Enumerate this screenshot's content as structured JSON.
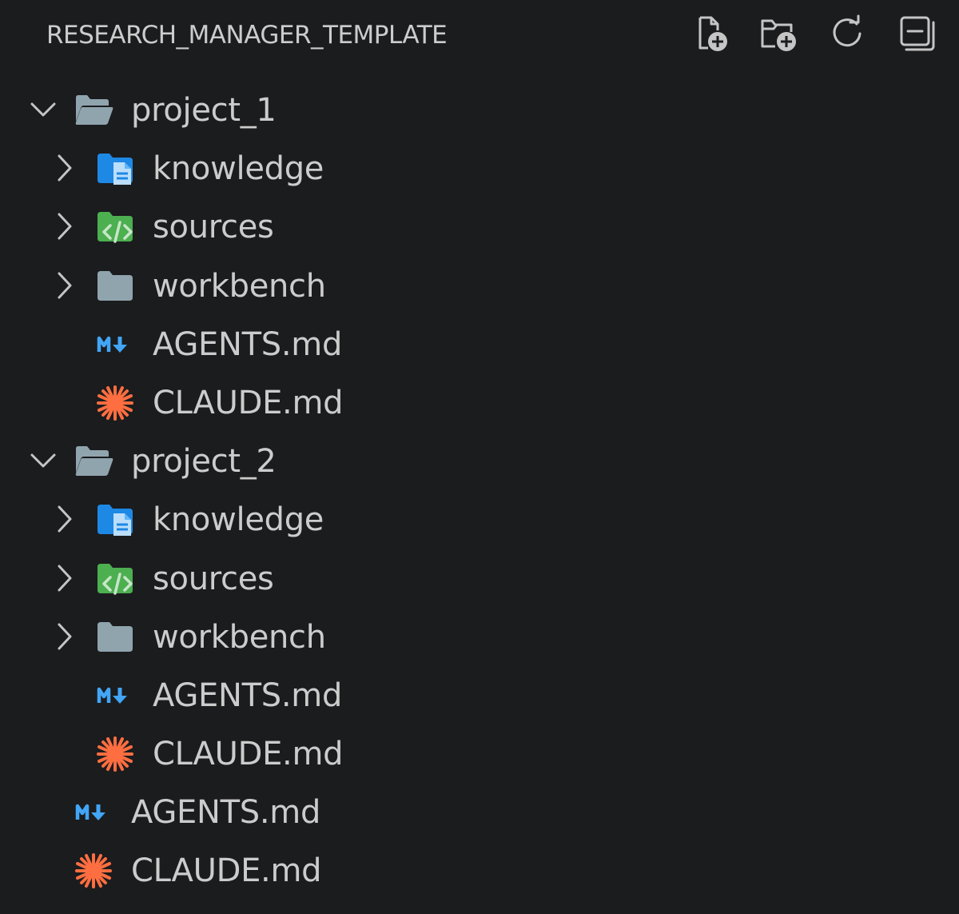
{
  "explorer": {
    "title": "RESEARCH_MANAGER_TEMPLATE"
  },
  "actions": [
    {
      "name": "new-file-button",
      "icon": "new-file-icon"
    },
    {
      "name": "new-folder-button",
      "icon": "new-folder-icon"
    },
    {
      "name": "refresh-explorer-button",
      "icon": "refresh-icon"
    },
    {
      "name": "collapse-folders-button",
      "icon": "collapse-all-icon"
    }
  ],
  "colors": {
    "background": "#1b1c1e",
    "text": "#cccccc",
    "folder_gray": "#90a4ae",
    "knowledge_blue": "#1e88e5",
    "sources_green": "#4caf50",
    "markdown_blue": "#42a5f5",
    "claude_orange": "#ff6e40"
  },
  "tree": [
    {
      "label": "project_1",
      "type": "folder-open",
      "depth": 0,
      "twistie": "expanded",
      "icon": "folder-open-icon"
    },
    {
      "label": "knowledge",
      "type": "folder",
      "depth": 1,
      "twistie": "collapsed",
      "icon": "folder-docs-icon"
    },
    {
      "label": "sources",
      "type": "folder",
      "depth": 1,
      "twistie": "collapsed",
      "icon": "folder-src-icon"
    },
    {
      "label": "workbench",
      "type": "folder",
      "depth": 1,
      "twistie": "collapsed",
      "icon": "folder-icon"
    },
    {
      "label": "AGENTS.md",
      "type": "file",
      "depth": 1,
      "twistie": "none",
      "icon": "markdown-icon"
    },
    {
      "label": "CLAUDE.md",
      "type": "file",
      "depth": 1,
      "twistie": "none",
      "icon": "claude-icon"
    },
    {
      "label": "project_2",
      "type": "folder-open",
      "depth": 0,
      "twistie": "expanded",
      "icon": "folder-open-icon"
    },
    {
      "label": "knowledge",
      "type": "folder",
      "depth": 1,
      "twistie": "collapsed",
      "icon": "folder-docs-icon"
    },
    {
      "label": "sources",
      "type": "folder",
      "depth": 1,
      "twistie": "collapsed",
      "icon": "folder-src-icon"
    },
    {
      "label": "workbench",
      "type": "folder",
      "depth": 1,
      "twistie": "collapsed",
      "icon": "folder-icon"
    },
    {
      "label": "AGENTS.md",
      "type": "file",
      "depth": 1,
      "twistie": "none",
      "icon": "markdown-icon"
    },
    {
      "label": "CLAUDE.md",
      "type": "file",
      "depth": 1,
      "twistie": "none",
      "icon": "claude-icon"
    },
    {
      "label": "AGENTS.md",
      "type": "file",
      "depth": 0,
      "twistie": "none",
      "icon": "markdown-icon"
    },
    {
      "label": "CLAUDE.md",
      "type": "file",
      "depth": 0,
      "twistie": "none",
      "icon": "claude-icon"
    }
  ]
}
